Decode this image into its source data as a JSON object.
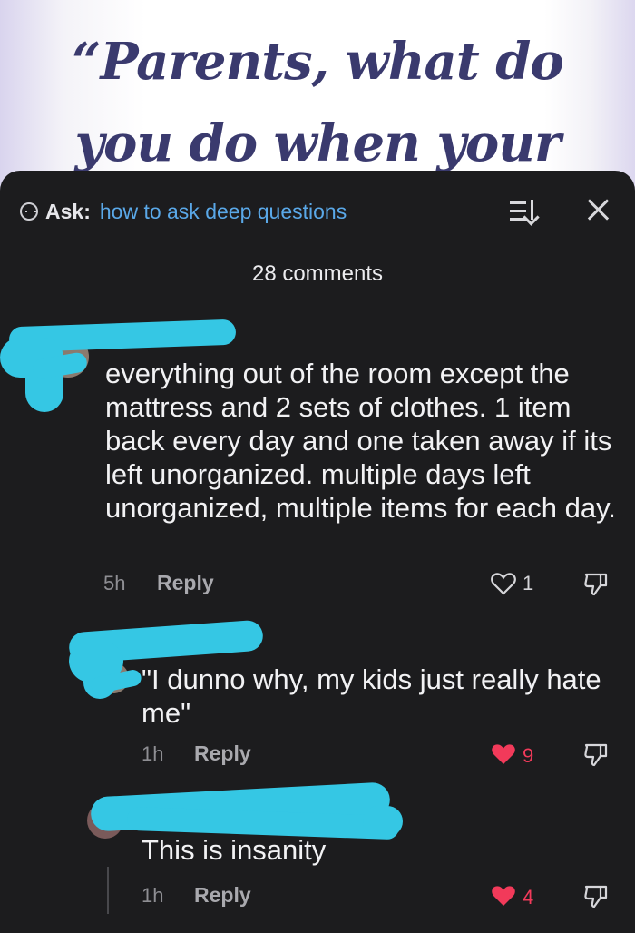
{
  "background": {
    "headline_line1": "“Parents, what do",
    "headline_line2": "you do when your"
  },
  "header": {
    "ask_label": "Ask:",
    "ask_link": "how to ask deep questions",
    "comment_count": "28 comments"
  },
  "comments": [
    {
      "text": "everything out of the room except the mattress and 2 sets of clothes. 1 item back every day and one taken away if its left unorganized. multiple days left unorganized, multiple items for each day.",
      "time": "5h",
      "reply_label": "Reply",
      "likes": "1",
      "liked": false
    },
    {
      "text": "\"I dunno why, my kids just really hate me\"",
      "time": "1h",
      "reply_label": "Reply",
      "likes": "9",
      "liked": true
    },
    {
      "text": "This is insanity",
      "time": "1h",
      "reply_label": "Reply",
      "likes": "4",
      "liked": true
    }
  ],
  "colors": {
    "sheet": "#1c1c1e",
    "link": "#5aa8e8",
    "liked_heart": "#f23a5a",
    "redaction": "#35c7e4"
  },
  "icons": [
    "comment-bubble-icon",
    "sort-icon",
    "close-icon",
    "heart-icon",
    "dislike-icon"
  ]
}
